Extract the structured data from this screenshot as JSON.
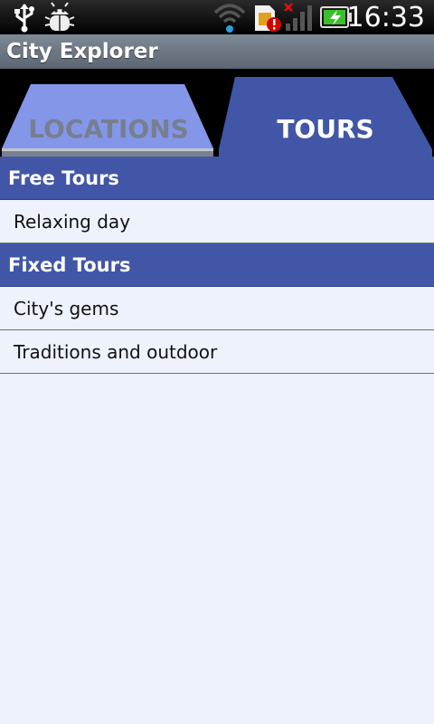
{
  "status_bar": {
    "time": "16:33",
    "icons": [
      "usb-icon",
      "debug-bug-icon",
      "wifi-icon",
      "sim-alert-icon",
      "signal-no-service-icon",
      "battery-charging-icon"
    ]
  },
  "app": {
    "title": "City Explorer"
  },
  "tabs": [
    {
      "label": "LOCATIONS",
      "selected": false
    },
    {
      "label": "TOURS",
      "selected": true
    }
  ],
  "sections": [
    {
      "header": "Free Tours",
      "items": [
        "Relaxing day"
      ]
    },
    {
      "header": "Fixed Tours",
      "items": [
        "City's gems",
        "Traditions and outdoor"
      ]
    }
  ],
  "colors": {
    "section_header": "#4156a6",
    "tab_selected": "#4156a6",
    "tab_unselected": "#8496e8",
    "list_background": "#eef2fd"
  }
}
